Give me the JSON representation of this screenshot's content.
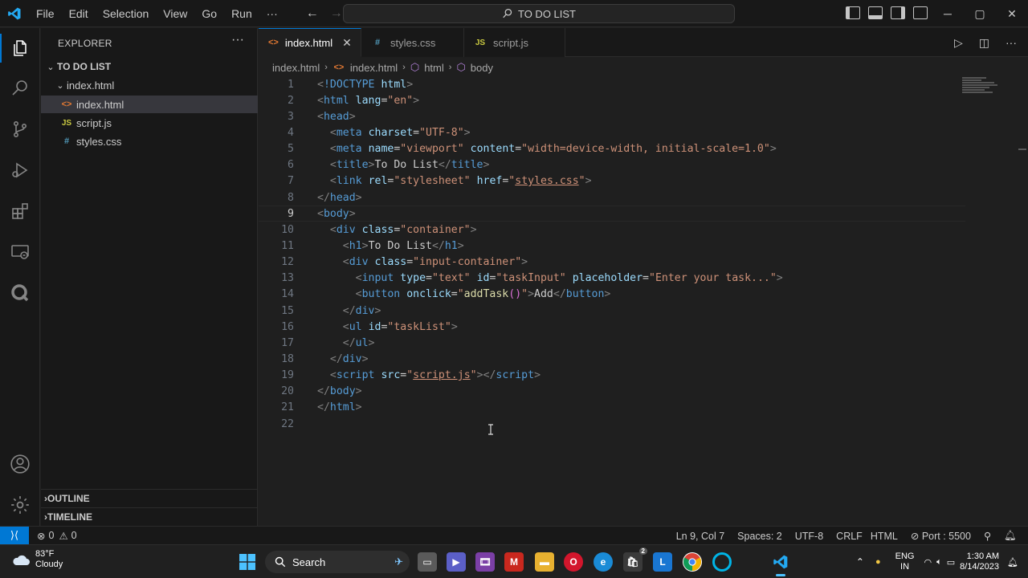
{
  "titlebar": {
    "menu": [
      "File",
      "Edit",
      "Selection",
      "View",
      "Go",
      "Run",
      "···"
    ],
    "search_text": "TO DO LIST",
    "window_controls": [
      "─",
      "▢",
      "✕"
    ]
  },
  "explorer": {
    "title": "EXPLORER",
    "more": "···",
    "root": "TO DO LIST",
    "folder": "index.html",
    "files": [
      {
        "name": "index.html",
        "icon": "<>"
      },
      {
        "name": "script.js",
        "icon": "JS"
      },
      {
        "name": "styles.css",
        "icon": "#"
      }
    ],
    "outline": "OUTLINE",
    "timeline": "TIMELINE"
  },
  "tabs": [
    {
      "label": "index.html",
      "icon": "<>"
    },
    {
      "label": "styles.css",
      "icon": "#"
    },
    {
      "label": "script.js",
      "icon": "JS"
    }
  ],
  "breadcrumbs": [
    "index.html",
    "index.html",
    "html",
    "body"
  ],
  "code": {
    "line_numbers": [
      "1",
      "2",
      "3",
      "4",
      "5",
      "6",
      "7",
      "8",
      "9",
      "10",
      "11",
      "12",
      "13",
      "14",
      "15",
      "16",
      "17",
      "18",
      "19",
      "20",
      "21",
      "22"
    ]
  },
  "statusbar": {
    "errors": "0",
    "warnings": "0",
    "position": "Ln 9, Col 7",
    "spaces": "Spaces: 2",
    "encoding": "UTF-8",
    "eol": "CRLF",
    "language": "HTML",
    "port": "Port : 5500"
  },
  "taskbar": {
    "temp": "83°F",
    "condition": "Cloudy",
    "search": "Search",
    "lang_top": "ENG",
    "lang_bottom": "IN",
    "time": "1:30 AM",
    "date": "8/14/2023",
    "badge": "2"
  },
  "colors": {
    "accent": "#0078d4",
    "tag": "#569cd6",
    "attribute": "#9cdcfe",
    "string": "#ce9178"
  }
}
